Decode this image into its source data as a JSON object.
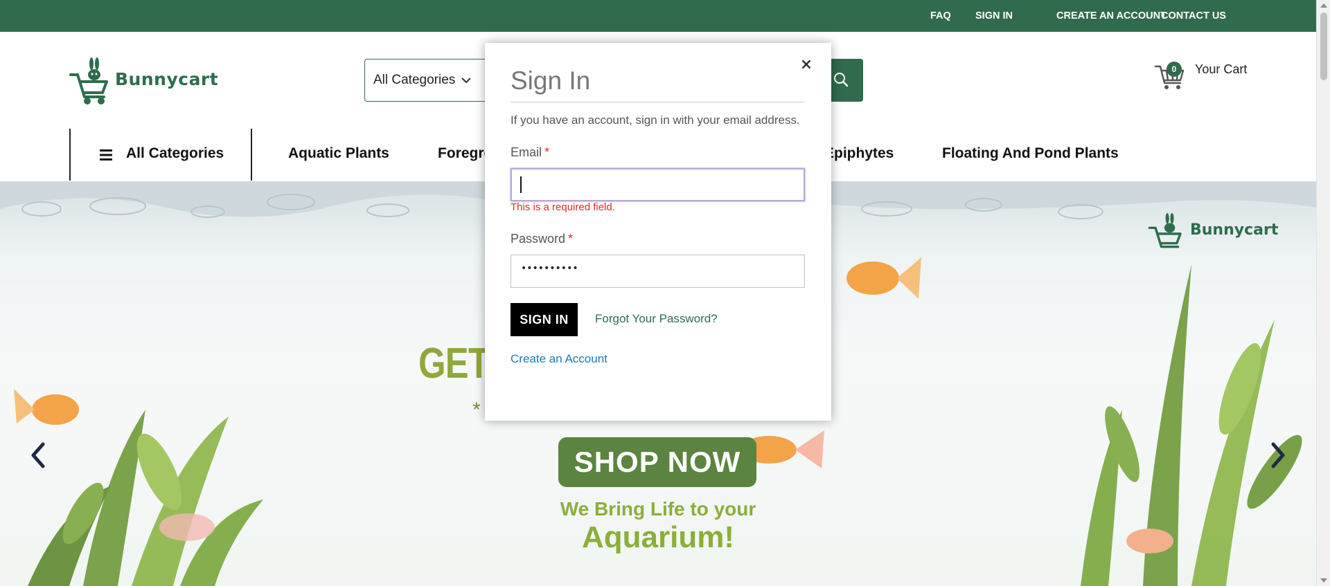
{
  "topbar": {
    "links": [
      "FAQ",
      "SIGN IN",
      "CREATE AN ACCOUNT",
      "CONTACT US"
    ]
  },
  "brand": {
    "name": "Bunnycart",
    "color": "#306b4d"
  },
  "search": {
    "category_selected": "All Categories",
    "icon": "search-icon"
  },
  "cart": {
    "count": "0",
    "label": "Your Cart",
    "icon": "cart-icon"
  },
  "nav": {
    "all_categories": "All Categories",
    "items": [
      "Aquatic Plants",
      "Foregro",
      "Epiphytes",
      "Floating And Pond Plants"
    ]
  },
  "hero": {
    "headline": "GET 1 UNT",
    "subline": "*                       S",
    "shop_now": "SHOP NOW",
    "tagline_1": "We Bring Life to your",
    "tagline_2": "Aquarium!",
    "logo_text": "Bunnycart"
  },
  "modal": {
    "title": "Sign In",
    "intro": "If you have an account, sign in with your email address.",
    "email_label": "Email",
    "email_value": "",
    "email_error": "This is a required field.",
    "password_label": "Password",
    "password_mask": "••••••••••",
    "required_mark": "*",
    "close": "×",
    "signin_button": "SIGN IN",
    "forgot_link": "Forgot Your Password?",
    "create_link": "Create an Account"
  },
  "colors": {
    "topbar": "#306b4d",
    "error": "#e02b27",
    "link_blue": "#1979c3",
    "hero_green": "#8fa83c",
    "shop_button": "#5b8440"
  }
}
